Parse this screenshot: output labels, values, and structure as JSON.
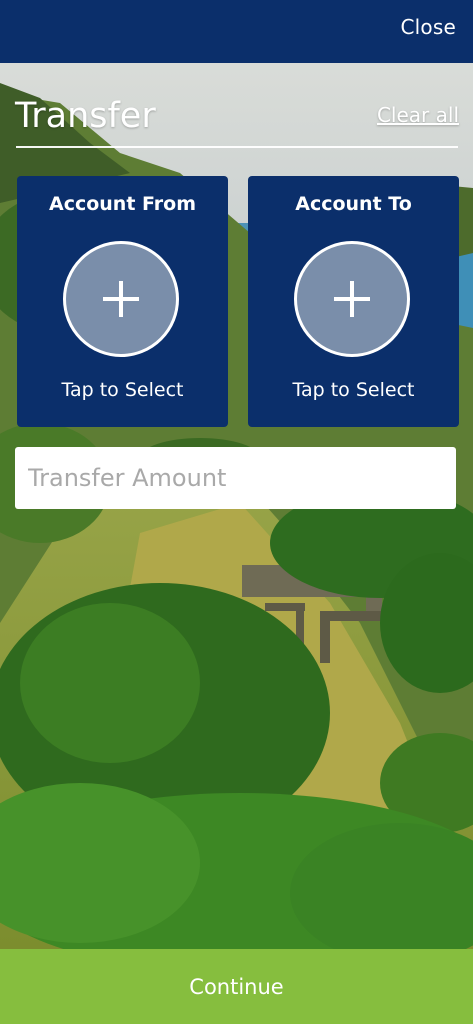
{
  "header": {
    "close_label": "Close"
  },
  "page": {
    "title": "Transfer",
    "clear_all_label": "Clear all"
  },
  "accounts": {
    "from": {
      "title": "Account From",
      "action_label": "Tap to Select",
      "icon": "plus-icon"
    },
    "to": {
      "title": "Account To",
      "action_label": "Tap to Select",
      "icon": "plus-icon"
    }
  },
  "amount": {
    "placeholder": "Transfer Amount",
    "value": ""
  },
  "footer": {
    "continue_label": "Continue"
  },
  "colors": {
    "navy": "#0b2f6b",
    "continue_green": "#86be3e",
    "circle_fill": "#7a8eaa",
    "white": "#ffffff"
  }
}
